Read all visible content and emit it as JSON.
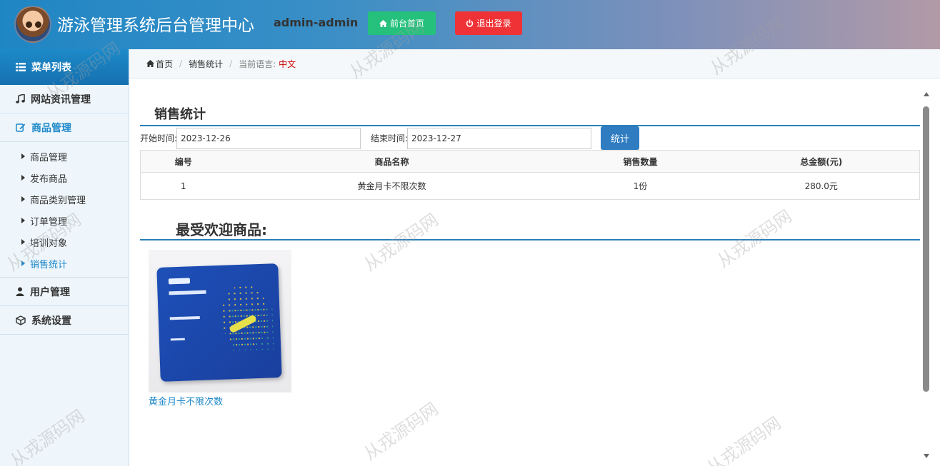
{
  "header": {
    "title": "游泳管理系统后台管理中心",
    "user": "admin-admin",
    "home_button": "前台首页",
    "logout_button": "退出登录"
  },
  "sidebar": {
    "menu_title": "菜单列表",
    "groups": [
      {
        "label": "网站资讯管理",
        "icon": "music-icon"
      },
      {
        "label": "商品管理",
        "icon": "edit-icon",
        "active": true,
        "items": [
          "商品管理",
          "发布商品",
          "商品类别管理",
          "订单管理",
          "培训对象",
          "销售统计"
        ],
        "active_item": "销售统计"
      },
      {
        "label": "用户管理",
        "icon": "user-icon"
      },
      {
        "label": "系统设置",
        "icon": "cube-icon"
      }
    ]
  },
  "breadcrumb": {
    "home": "首页",
    "current": "销售统计",
    "lang_label": "当前语言:",
    "lang_value": "中文"
  },
  "stats": {
    "title": "销售统计",
    "start_label": "开始时间:",
    "start_value": "2023-12-26",
    "end_label": "结束时间:",
    "end_value": "2023-12-27",
    "submit": "统计",
    "columns": [
      "编号",
      "商品名称",
      "销售数量",
      "总金额(元)"
    ],
    "rows": [
      [
        "1",
        "黄金月卡不限次数",
        "1份",
        "280.0元"
      ]
    ]
  },
  "popular": {
    "title": "最受欢迎商品:",
    "products": [
      {
        "name": "黄金月卡不限次数"
      }
    ]
  },
  "watermark": "从戎源码网",
  "colors": {
    "accent": "#1c87c9",
    "home_btn": "#24c07c",
    "logout_btn": "#ef3236",
    "stat_btn": "#2f7cc1"
  }
}
